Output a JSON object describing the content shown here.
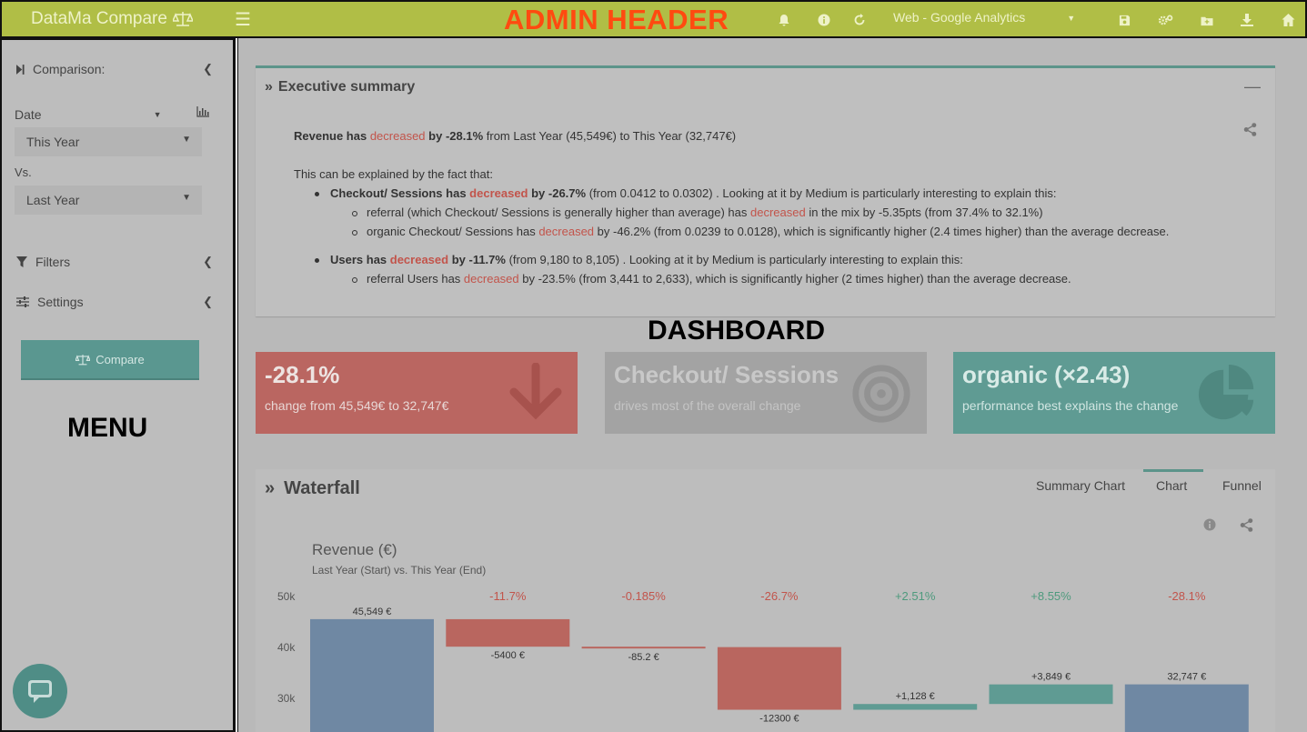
{
  "header": {
    "brand": "DataMa Compare",
    "annotation": "ADMIN HEADER",
    "source": "Web - Google Analytics",
    "icons": [
      "bell-icon",
      "info-icon",
      "refresh-icon",
      "save-icon",
      "settings-icon",
      "folder-icon",
      "download-icon",
      "home-icon"
    ]
  },
  "sidebar": {
    "comparison_label": "Comparison:",
    "date_label": "Date",
    "this_period": "This Year",
    "vs_label": "Vs.",
    "last_period": "Last Year",
    "filters_label": "Filters",
    "settings_label": "Settings",
    "compare_button": "Compare",
    "annotation": "MENU"
  },
  "exec": {
    "title": "Executive summary",
    "line1": {
      "a": "Revenue has ",
      "dec": "decreased",
      "b": " by -28.1%",
      "c": " from Last Year (45,549€) to This Year (32,747€)"
    },
    "intro": "This can be explained by the fact that:",
    "b1": {
      "a": "Checkout/ Sessions has ",
      "dec": "decreased",
      "b": " by -26.7%",
      "c": " (from 0.0412 to 0.0302) . Looking at it by Medium is particularly interesting to explain this:"
    },
    "b1s1": {
      "a": "referral (which Checkout/ Sessions is generally higher than average) has ",
      "dec": "decreased",
      "c": " in the mix by -5.35pts (from 37.4% to 32.1%)"
    },
    "b1s2": {
      "a": "organic Checkout/ Sessions has ",
      "dec": "decreased",
      "c": " by -46.2% (from 0.0239 to 0.0128), which is significantly higher (2.4 times higher) than the average decrease."
    },
    "b2": {
      "a": "Users has ",
      "dec": "decreased",
      "b": " by -11.7%",
      "c": " (from 9,180 to 8,105) . Looking at it by Medium is particularly interesting to explain this:"
    },
    "b2s1": {
      "a": "referral Users has ",
      "dec": "decreased",
      "c": " by -23.5% (from 3,441 to 2,633), which is significantly higher (2 times higher) than the average decrease."
    }
  },
  "dashboard_annotation": "DASHBOARD",
  "kpis": [
    {
      "big": "-28.1%",
      "small": "change from 45,549€ to 32,747€",
      "icon": "arrow-down-icon"
    },
    {
      "big": "Checkout/ Sessions",
      "small": "drives most of the overall change",
      "icon": "target-icon"
    },
    {
      "big": "organic (×2.43)",
      "small": "performance best explains the change",
      "icon": "pie-chart-icon"
    }
  ],
  "waterfall": {
    "title": "Waterfall",
    "tabs": [
      "Summary Chart",
      "Chart",
      "Funnel"
    ],
    "active_tab": "Chart"
  },
  "chart_data": {
    "type": "bar",
    "title": "Revenue (€)",
    "subtitle": "Last Year (Start) vs. This Year (End)",
    "y_ticks": [
      "50k",
      "40k",
      "30k"
    ],
    "ylim": [
      25000,
      50000
    ],
    "bars": [
      {
        "start": 0,
        "end": 45549,
        "label": "45,549 €",
        "pct": "",
        "kind": "total"
      },
      {
        "start": 45549,
        "end": 40149,
        "label": "-5400 €",
        "pct": "-11.7%",
        "kind": "neg"
      },
      {
        "start": 40149,
        "end": 40064,
        "label": "-85.2 €",
        "pct": "-0.185%",
        "kind": "neg"
      },
      {
        "start": 40064,
        "end": 27764,
        "label": "-12300 €",
        "pct": "-26.7%",
        "kind": "neg"
      },
      {
        "start": 27764,
        "end": 28892,
        "label": "+1,128 €",
        "pct": "+2.51%",
        "kind": "pos"
      },
      {
        "start": 28892,
        "end": 32741,
        "label": "+3,849 €",
        "pct": "+8.55%",
        "kind": "pos"
      },
      {
        "start": 0,
        "end": 32747,
        "label": "32,747 €",
        "pct": "-28.1%",
        "kind": "total"
      }
    ],
    "colors": {
      "total": "#6f88a3",
      "neg": "#b9665f",
      "pos": "#5f9b93",
      "neg_text": "#c2544b",
      "pos_text": "#4e9a7d"
    }
  }
}
